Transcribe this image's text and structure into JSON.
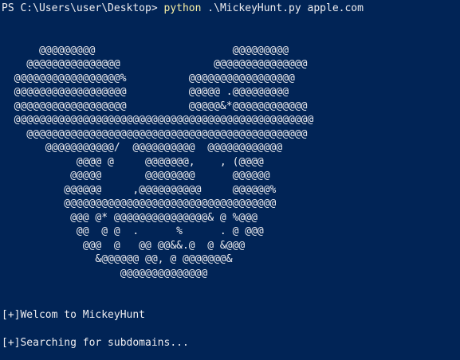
{
  "prompt": "PS C:\\Users\\user\\Desktop>",
  "command": "python",
  "args": " .\\MickeyHunt.py apple.com",
  "ascii_art": [
    "      @@@@@@@@@                      @@@@@@@@@",
    "    @@@@@@@@@@@@@@@               @@@@@@@@@@@@@@@",
    "  @@@@@@@@@@@@@@@@@%          @@@@@@@@@@@@@@@@@",
    "  @@@@@@@@@@@@@@@@@@          @@@@@ .@@@@@@@@@",
    "  @@@@@@@@@@@@@@@@@@          @@@@@&*@@@@@@@@@@@@",
    "  @@@@@@@@@@@@@@@@@@@@@@@@@@@@@@@@@@@@@@@@@@@@@@@@",
    "    @@@@@@@@@@@@@@@@@@@@@@@@@@@@@@@@@@@@@@@@@@@@@",
    "       @@@@@@@@@@@/  @@@@@@@@@@  @@@@@@@@@@@@",
    "            @@@@ @     @@@@@@@,    , (@@@@",
    "           @@@@@       @@@@@@@@      @@@@@@",
    "          @@@@@@     ,@@@@@@@@@@     @@@@@@%",
    "          @@@@@@@@@@@@@@@@@@@@@@@@@@@@@@@@@@",
    "           @@@ @* @@@@@@@@@@@@@@@& @ %@@@",
    "            @@  @ @  .      %      . @ @@@",
    "             @@@  @   @@ @@&&.@  @ &@@@",
    "               &@@@@@@ @@, @ @@@@@@@&",
    "                   @@@@@@@@@@@@@@"
  ],
  "messages": [
    "[+]Welcom to MickeyHunt",
    "[+]Searching for subdomains..."
  ]
}
